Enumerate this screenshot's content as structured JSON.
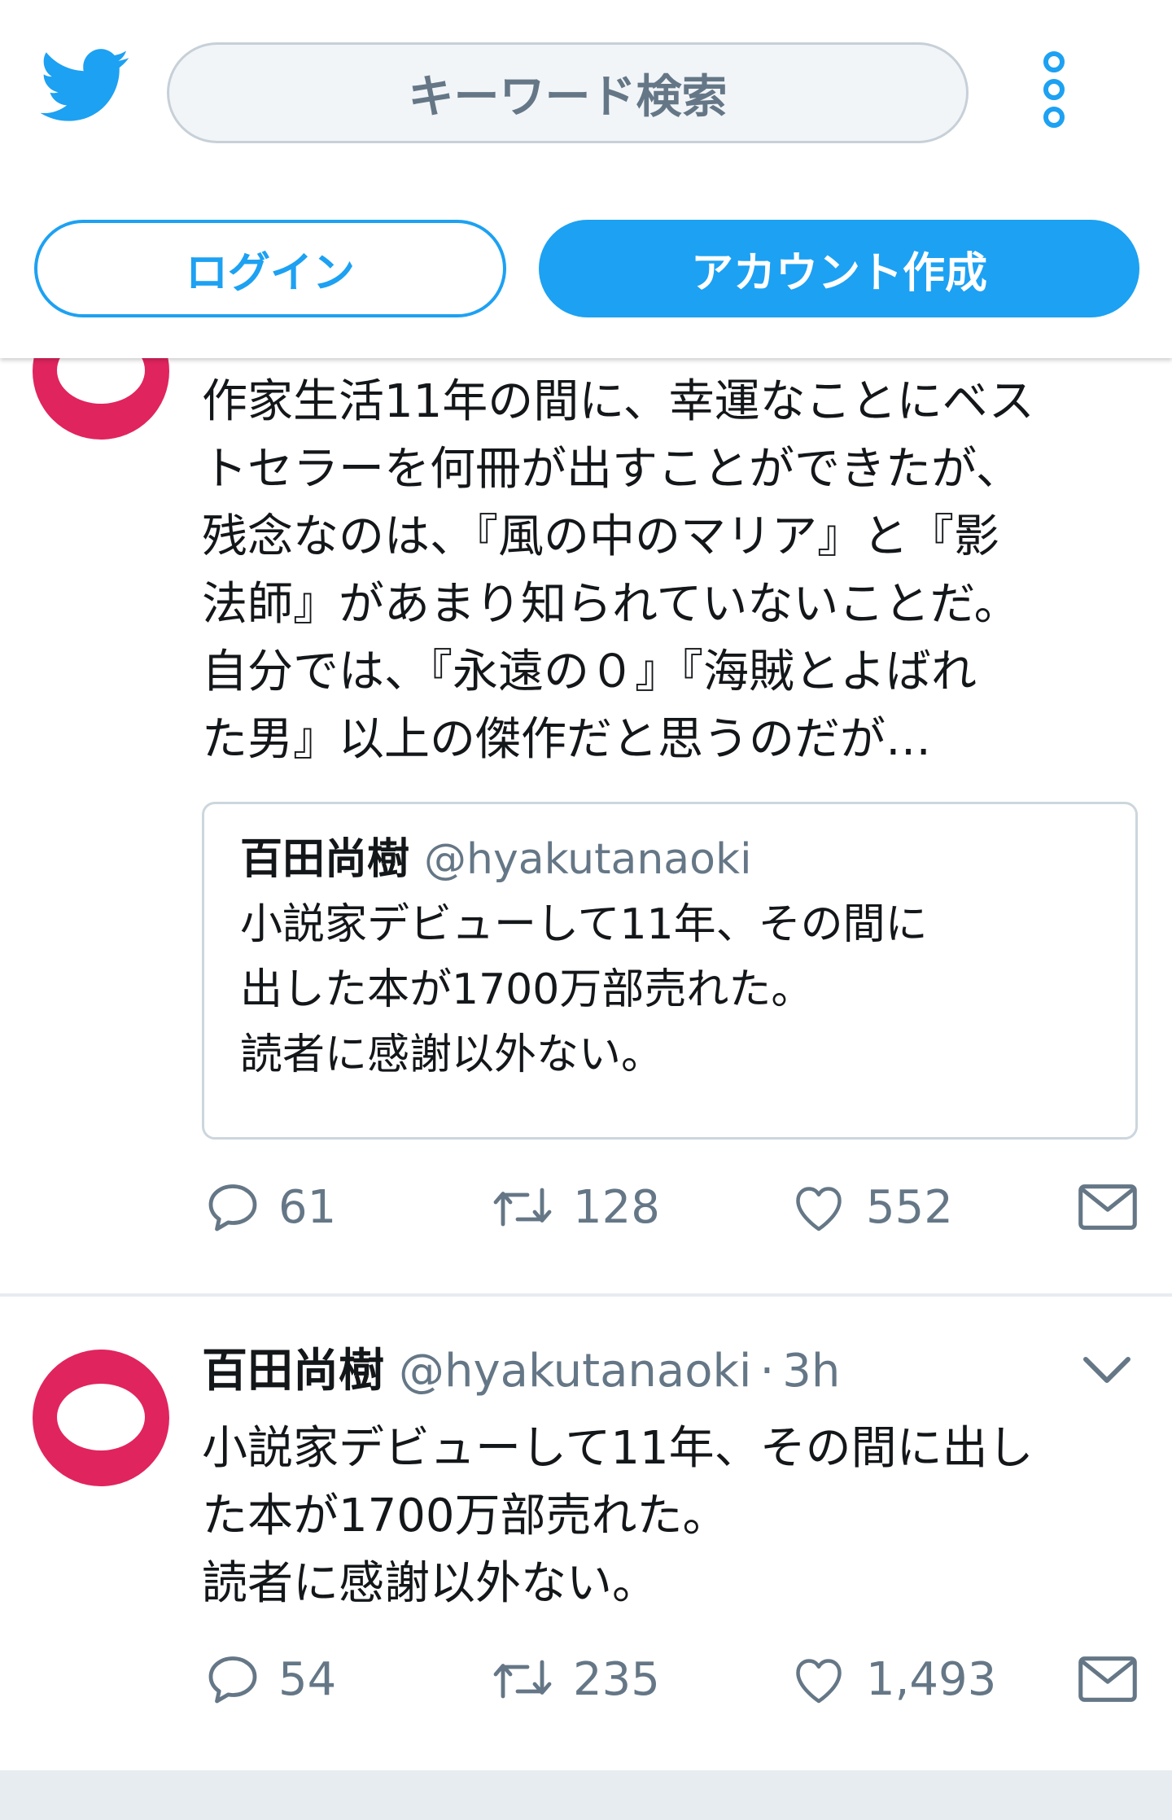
{
  "header": {
    "search_placeholder": "キーワード検索",
    "login_label": "ログイン",
    "signup_label": "アカウント作成"
  },
  "colors": {
    "brand": "#1da1f2",
    "avatar": "#e0245e",
    "muted": "#657786"
  },
  "tweets": [
    {
      "text_lines": [
        "作家生活11年の間に、幸運なことにベス",
        "トセラーを何冊が出すことができたが、",
        "残念なのは、『風の中のマリア』と『影",
        "法師』があまり知られていないことだ。",
        "自分では、『永遠の０』『海賊とよばれ",
        "た男』以上の傑作だと思うのだが…"
      ],
      "quote": {
        "name": "百田尚樹",
        "handle": "@hyakutanaoki",
        "lines": [
          "小説家デビューして11年、その間に",
          "出した本が1700万部売れた。",
          "読者に感謝以外ない。"
        ]
      },
      "replies": "61",
      "retweets": "128",
      "likes": "552"
    },
    {
      "name": "百田尚樹",
      "handle": "@hyakutanaoki",
      "separator": "·",
      "time": "3h",
      "text_lines": [
        "小説家デビューして11年、その間に出し",
        "た本が1700万部売れた。",
        "読者に感謝以外ない。"
      ],
      "replies": "54",
      "retweets": "235",
      "likes": "1,493"
    }
  ]
}
